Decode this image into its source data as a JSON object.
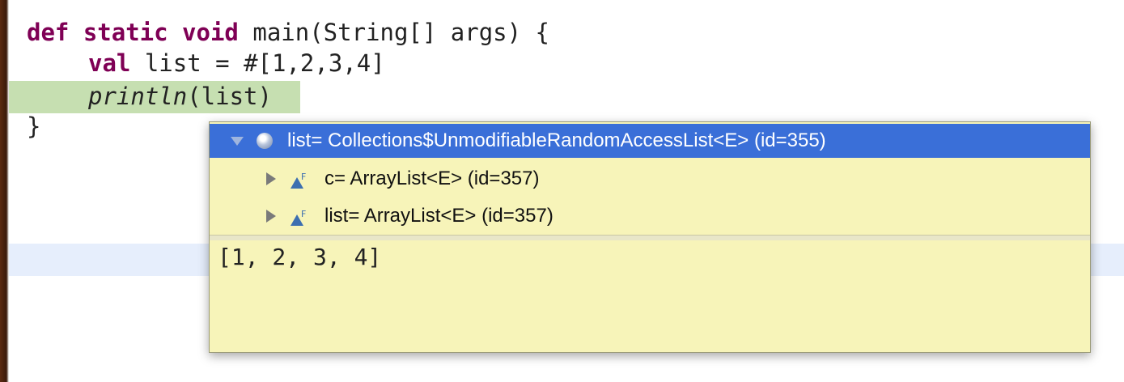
{
  "editor": {
    "code_lines": [
      {
        "keyword": "def static void",
        "rest": " main(String[] args) {"
      },
      {
        "keyword": "val",
        "rest": " list = #[1,2,3,4]"
      },
      {
        "italic": "println",
        "rest": "(list)"
      },
      {
        "rest": "}"
      }
    ],
    "colors": {
      "keyword": "#7f0055",
      "suspended_line_highlight": "#c6dfb1",
      "current_line_highlight": "#e6eefc"
    }
  },
  "popup": {
    "tree": [
      {
        "icon": "object-instance-icon",
        "expanded": true,
        "text": "list= Collections$UnmodifiableRandomAccessList<E>  (id=355)"
      },
      {
        "icon": "final-field-icon",
        "expanded": false,
        "text": "c= ArrayList<E>  (id=357)"
      },
      {
        "icon": "final-field-icon",
        "expanded": false,
        "text": "list= ArrayList<E>  (id=357)"
      }
    ],
    "detail": "[1, 2, 3, 4]",
    "colors": {
      "background": "#f7f4b9",
      "selection": "#3a6fd8"
    }
  }
}
